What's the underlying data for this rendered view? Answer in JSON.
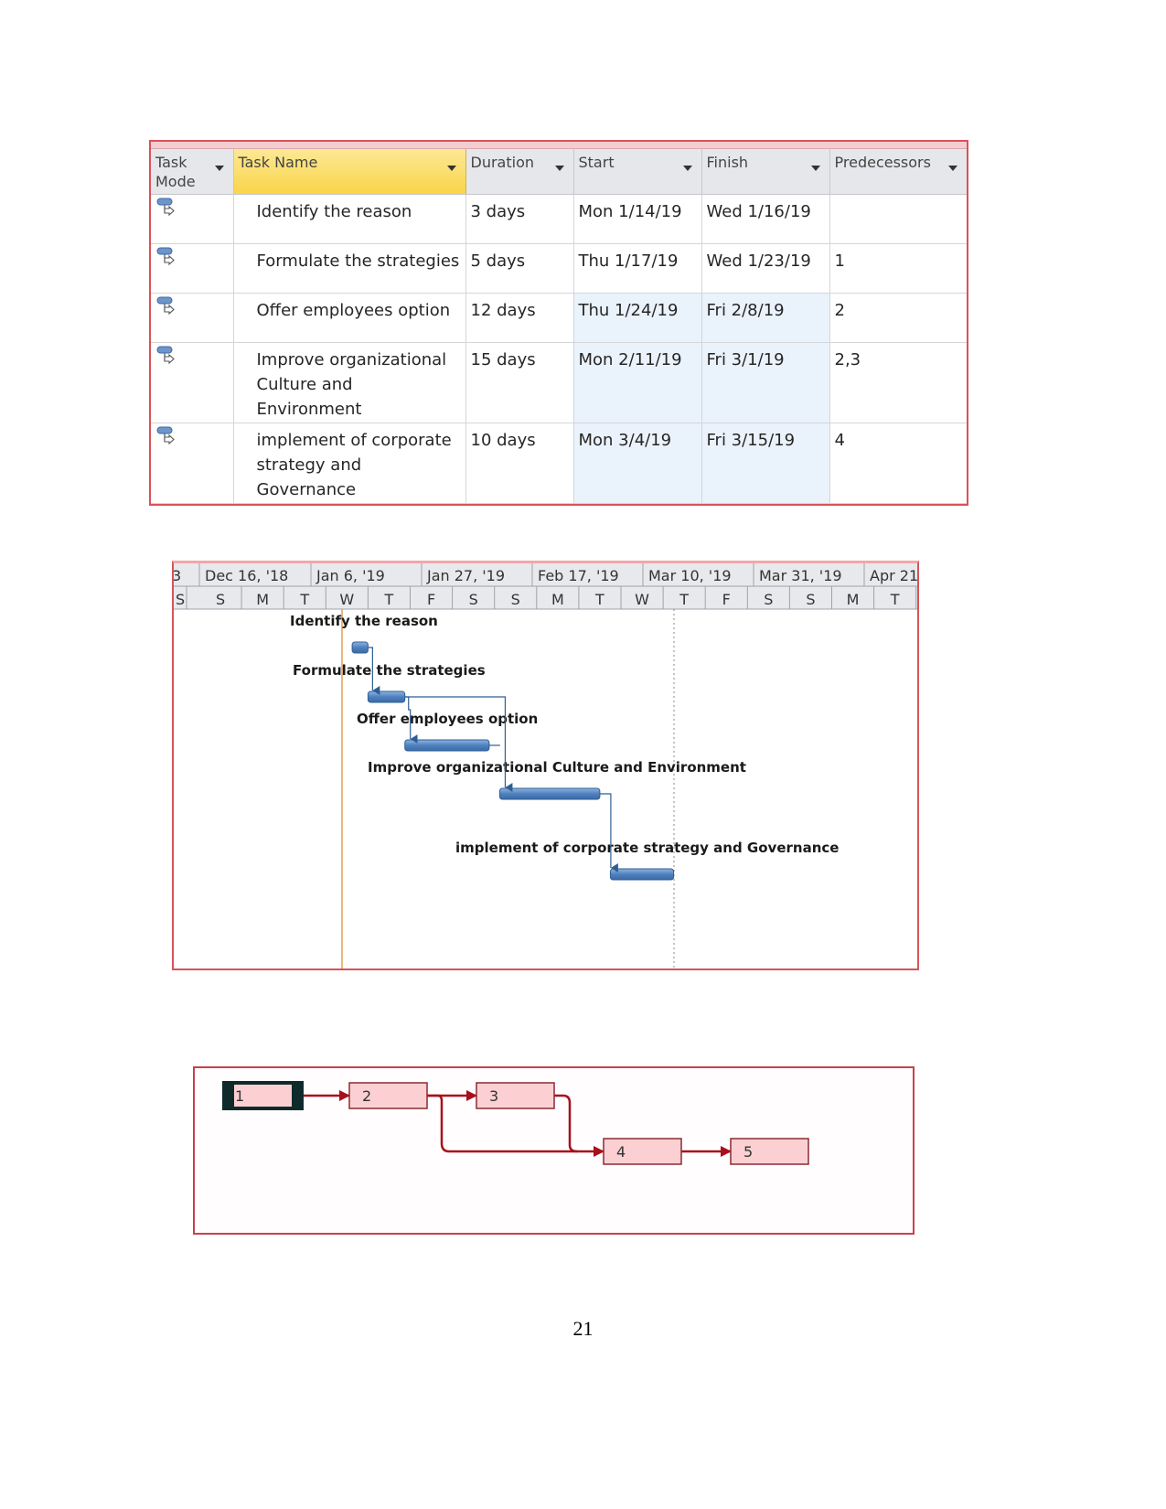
{
  "table": {
    "columns": [
      {
        "label": "Task Mode",
        "line1": "Task",
        "line2": "Mode"
      },
      {
        "label": "Task Name"
      },
      {
        "label": "Duration"
      },
      {
        "label": "Start"
      },
      {
        "label": "Finish"
      },
      {
        "label": "Predecessors"
      }
    ],
    "rows": [
      {
        "mode_icon": "auto-scheduled-task-icon",
        "name_lines": [
          "Identify the reason"
        ],
        "duration": "3 days",
        "start": "Mon 1/14/19",
        "finish": "Wed 1/16/19",
        "predecessors": ""
      },
      {
        "mode_icon": "auto-scheduled-task-icon",
        "name_lines": [
          "Formulate the strategies"
        ],
        "duration": "5 days",
        "start": "Thu 1/17/19",
        "finish": "Wed 1/23/19",
        "predecessors": "1"
      },
      {
        "mode_icon": "auto-scheduled-task-icon",
        "name_lines": [
          "Offer employees option"
        ],
        "duration": "12 days",
        "start": "Thu 1/24/19",
        "finish": "Fri 2/8/19",
        "predecessors": "2"
      },
      {
        "mode_icon": "auto-scheduled-task-icon",
        "name_lines": [
          "Improve organizational",
          "Culture and",
          "Environment"
        ],
        "duration": "15 days",
        "start": "Mon 2/11/19",
        "finish": "Fri 3/1/19",
        "predecessors": "2,3"
      },
      {
        "mode_icon": "auto-scheduled-task-icon",
        "name_lines": [
          "implement of corporate",
          "strategy and",
          "Governance"
        ],
        "duration": "10 days",
        "start": "Mon 3/4/19",
        "finish": "Fri 3/15/19",
        "predecessors": "4"
      }
    ]
  },
  "gantt": {
    "timescale_top": [
      "3",
      "Dec 16, '18",
      "Jan 6, '19",
      "Jan 27, '19",
      "Feb 17, '19",
      "Mar 10, '19",
      "Mar 31, '19",
      "Apr 21"
    ],
    "timescale_bottom": [
      "S",
      "S",
      "M",
      "T",
      "W",
      "T",
      "F",
      "S",
      "S",
      "M",
      "T",
      "W",
      "T",
      "F",
      "S",
      "S",
      "M",
      "T"
    ],
    "tasks": [
      {
        "id": 1,
        "label": "Identify the reason",
        "start": "2019-01-14",
        "finish": "2019-01-16",
        "predecessors": []
      },
      {
        "id": 2,
        "label": "Formulate the strategies",
        "start": "2019-01-17",
        "finish": "2019-01-23",
        "predecessors": [
          1
        ]
      },
      {
        "id": 3,
        "label": "Offer employees option",
        "start": "2019-01-24",
        "finish": "2019-02-08",
        "predecessors": [
          2
        ]
      },
      {
        "id": 4,
        "label": "Improve organizational Culture and Environment",
        "start": "2019-02-11",
        "finish": "2019-03-01",
        "predecessors": [
          2,
          3
        ]
      },
      {
        "id": 5,
        "label": "implement of corporate strategy and Governance",
        "start": "2019-03-04",
        "finish": "2019-03-15",
        "predecessors": [
          4
        ]
      }
    ],
    "bar_color": "#4f81bd",
    "today_line_color": "#e0a050"
  },
  "network": {
    "nodes": [
      {
        "id": "1",
        "label": "1",
        "selected": true
      },
      {
        "id": "2",
        "label": "2",
        "selected": false
      },
      {
        "id": "3",
        "label": "3",
        "selected": false
      },
      {
        "id": "4",
        "label": "4",
        "selected": false
      },
      {
        "id": "5",
        "label": "5",
        "selected": false
      }
    ],
    "links": [
      [
        "1",
        "2"
      ],
      [
        "2",
        "3"
      ],
      [
        "2",
        "4"
      ],
      [
        "3",
        "4"
      ],
      [
        "4",
        "5"
      ]
    ],
    "node_fill": "#fcd0d3",
    "link_color": "#a8101c"
  },
  "page_number": "21"
}
